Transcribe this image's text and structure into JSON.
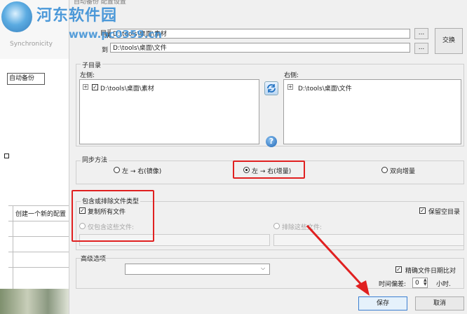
{
  "dialog": {
    "title": "自动备份 配置设置",
    "dir_label": "目录",
    "from_label": "从",
    "from_value": "D:\\tools\\桌面\\素材",
    "to_label": "到",
    "to_value": "D:\\tools\\桌面\\文件",
    "browse_label": "...",
    "swap_label": "交换",
    "subdir_label": "子目录",
    "left_label": "左侧:",
    "right_label": "右侧:",
    "left_tree_item": "D:\\tools\\桌面\\素材",
    "right_tree_item": "D:\\tools\\桌面\\文件",
    "sync_method_label": "同步方法",
    "mirror_label": "左 → 右(镜像)",
    "incremental_label": "左 → 右(增量)",
    "bidirectional_label": "双向增量",
    "filetype_label": "包含或排除文件类型",
    "copy_all_label": "复制所有文件",
    "keep_empty_label": "保留空目录",
    "only_include_label": "仅包含这些文件:",
    "exclude_label": "排除这些文件:",
    "advanced_label": "高级选项",
    "precise_date_label": "精确文件日期比对",
    "time_offset_label": "时间偏差:",
    "time_offset_value": "0",
    "hours_label": "小时.",
    "save_label": "保存",
    "cancel_label": "取消"
  },
  "background": {
    "sync_brand": "Synchronicity",
    "auto_backup_label": "自动备份",
    "create_label": "创建一个新的配置"
  },
  "watermark": {
    "title": "河东软件园",
    "url": "www.pc0359.cn"
  },
  "colors": {
    "highlight": "#e02020",
    "watermark": "#3a8fd6"
  },
  "icons": {
    "refresh": "refresh-icon",
    "help": "help-icon"
  }
}
